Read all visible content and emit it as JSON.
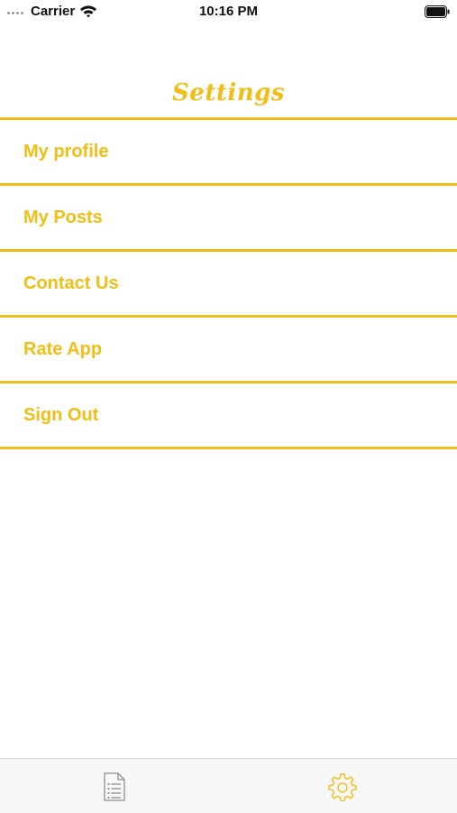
{
  "status_bar": {
    "carrier": "Carrier",
    "time": "10:16 PM",
    "icons": [
      "signal-dots-icon",
      "wifi-icon",
      "battery-icon"
    ]
  },
  "nav": {
    "title": "Settings"
  },
  "menu": {
    "items": [
      {
        "label": "My profile"
      },
      {
        "label": "My Posts"
      },
      {
        "label": "Contact Us"
      },
      {
        "label": "Rate App"
      },
      {
        "label": "Sign Out"
      }
    ]
  },
  "tab_bar": {
    "tabs": [
      {
        "icon": "list-document-icon",
        "selected": false
      },
      {
        "icon": "gear-icon",
        "selected": true
      }
    ]
  },
  "colors": {
    "accent": "#f2bd14",
    "inactive_icon": "#8e8e93",
    "tab_bar_bg": "#f7f7f7"
  }
}
